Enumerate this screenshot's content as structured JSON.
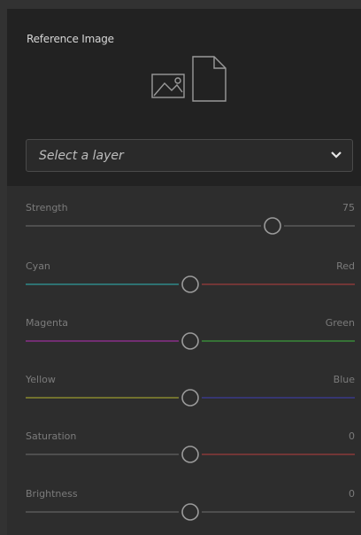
{
  "reference": {
    "title": "Reference Image",
    "image_icon": "image-icon",
    "document_icon": "document-icon"
  },
  "select": {
    "value": "Select a layer",
    "icon": "chevron-down-icon"
  },
  "sliders": [
    {
      "name": "strength",
      "label": "Strength",
      "right": "75",
      "value": 0.75,
      "left_color": "#5a5a5a",
      "right_color": "#5a5a5a"
    },
    {
      "name": "cyan-red",
      "label": "Cyan",
      "right": "Red",
      "value": 0.5,
      "left_color": "#2f8a8a",
      "right_color": "#8a3a3a"
    },
    {
      "name": "magenta-green",
      "label": "Magenta",
      "right": "Green",
      "value": 0.5,
      "left_color": "#8a2f8a",
      "right_color": "#3a8a3a"
    },
    {
      "name": "yellow-blue",
      "label": "Yellow",
      "right": "Blue",
      "value": 0.5,
      "left_color": "#8a8a2f",
      "right_color": "#3a3a8a"
    },
    {
      "name": "saturation",
      "label": "Saturation",
      "right": "0",
      "value": 0.5,
      "left_color": "#5a5a5a",
      "right_color": "#8a3a3a"
    },
    {
      "name": "brightness",
      "label": "Brightness",
      "right": "0",
      "value": 0.5,
      "left_color": "#5a5a5a",
      "right_color": "#5a5a5a"
    }
  ]
}
